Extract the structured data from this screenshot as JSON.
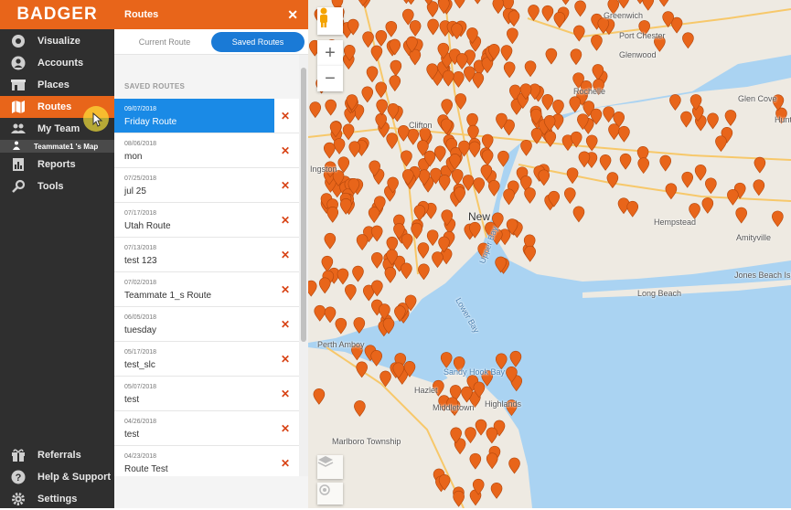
{
  "app": {
    "logo": "BADGER"
  },
  "nav": {
    "items": [
      {
        "label": "Visualize",
        "icon": "eye-icon"
      },
      {
        "label": "Accounts",
        "icon": "user-icon"
      },
      {
        "label": "Places",
        "icon": "building-icon"
      },
      {
        "label": "Routes",
        "icon": "map-icon"
      },
      {
        "label": "My Team",
        "icon": "team-icon"
      },
      {
        "label": "Reports",
        "icon": "report-icon"
      },
      {
        "label": "Tools",
        "icon": "tools-icon"
      }
    ],
    "sub_item": {
      "label": "Teammate1 's Map",
      "icon": "person-icon"
    },
    "bottom": [
      {
        "label": "Referrals",
        "icon": "gift-icon"
      },
      {
        "label": "Help & Support",
        "icon": "help-icon"
      },
      {
        "label": "Settings",
        "icon": "gear-icon"
      }
    ]
  },
  "panel": {
    "title": "Routes",
    "tabs": {
      "current": "Current Route",
      "saved": "Saved Routes"
    },
    "section_heading": "SAVED ROUTES",
    "routes": [
      {
        "date": "09/07/2018",
        "name": "Friday Route",
        "selected": true
      },
      {
        "date": "08/06/2018",
        "name": "mon"
      },
      {
        "date": "07/25/2018",
        "name": "jul 25"
      },
      {
        "date": "07/17/2018",
        "name": "Utah Route"
      },
      {
        "date": "07/13/2018",
        "name": "test 123"
      },
      {
        "date": "07/02/2018",
        "name": "Teammate 1_s Route"
      },
      {
        "date": "06/05/2018",
        "name": "tuesday"
      },
      {
        "date": "05/17/2018",
        "name": "test_slc"
      },
      {
        "date": "05/07/2018",
        "name": "test"
      },
      {
        "date": "04/26/2018",
        "name": "test"
      },
      {
        "date": "04/23/2018",
        "name": "Route Test"
      }
    ],
    "delete_glyph": "✕"
  },
  "map": {
    "zoom_in": "+",
    "zoom_out": "−",
    "labels": [
      "Greenwich",
      "Port Chester",
      "Glen Cove",
      "Huntington",
      "Clifton",
      "Hempstead",
      "Amityville",
      "Jones Beach Island",
      "Long Beach",
      "Perth Amboy",
      "Middletown",
      "Hazlet",
      "Highlands",
      "Marlboro Township",
      "Lower Bay",
      "Upper Bay",
      "Sandy Hook Bay",
      "Ingston",
      "New",
      "Glenwood",
      "Rochelle"
    ],
    "water_color": "#aad3f2",
    "land_color": "#eeeae2",
    "pin_color": "#e8651a"
  }
}
